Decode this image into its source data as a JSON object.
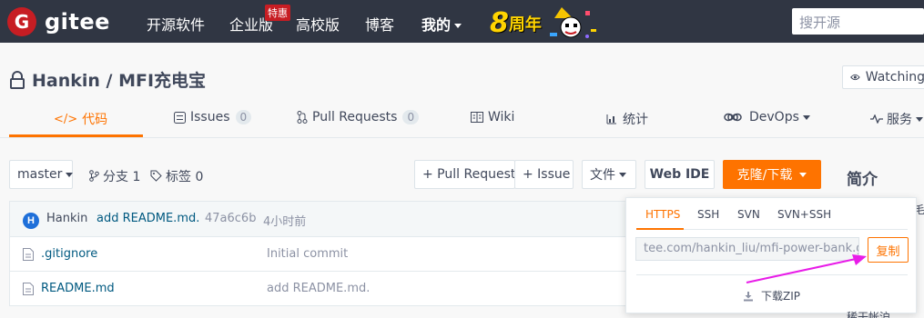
{
  "topnav": {
    "logo_mark": "G",
    "logo_text": "gitee",
    "items": [
      "开源软件",
      "企业版",
      "高校版",
      "博客"
    ],
    "enterprise_badge": "特惠",
    "mine": "我的",
    "anniversary_num": "8",
    "anniversary_text": "周年",
    "search_placeholder": "搜开源",
    "bg_color": "#303643",
    "brand_color": "#c71d23"
  },
  "repo": {
    "title": "Hankin / MFI充电宝",
    "watching": "Watching"
  },
  "tabs": [
    {
      "label": "代码",
      "icon": "code-icon"
    },
    {
      "label": "Issues",
      "count": "0",
      "icon": "issues-icon"
    },
    {
      "label": "Pull Requests",
      "count": "0",
      "icon": "pull-request-icon"
    },
    {
      "label": "Wiki",
      "icon": "wiki-icon"
    },
    {
      "label": "统计",
      "icon": "stats-icon"
    },
    {
      "label": "DevOps",
      "icon": "devops-icon"
    },
    {
      "label": "服务",
      "icon": "service-icon"
    }
  ],
  "toolbar": {
    "branch": "master",
    "branches": "分支 1",
    "tags": "标签 0",
    "pull_request": "+ Pull Request",
    "issue": "+ Issue",
    "file": "文件",
    "web_ide": "Web IDE",
    "clone": "克隆/下载",
    "intro": "简介",
    "accent_color": "#fe7300"
  },
  "commit": {
    "avatar": "H",
    "author": "Hankin",
    "message": "add README.md.",
    "hash": "47a6c6b",
    "time": "4小时前"
  },
  "files": [
    {
      "name": ".gitignore",
      "message": "Initial commit"
    },
    {
      "name": "README.md",
      "message": "add README.md."
    }
  ],
  "clone_panel": {
    "tabs": [
      "HTTPS",
      "SSH",
      "SVN",
      "SVN+SSH"
    ],
    "url": "tee.com/hankin_liu/mfi-power-bank.git",
    "copy": "复制",
    "download_zip": "下载ZIP"
  },
  "edge": {
    "right_top": "毛",
    "right_bottom": "稀干帐沪"
  }
}
